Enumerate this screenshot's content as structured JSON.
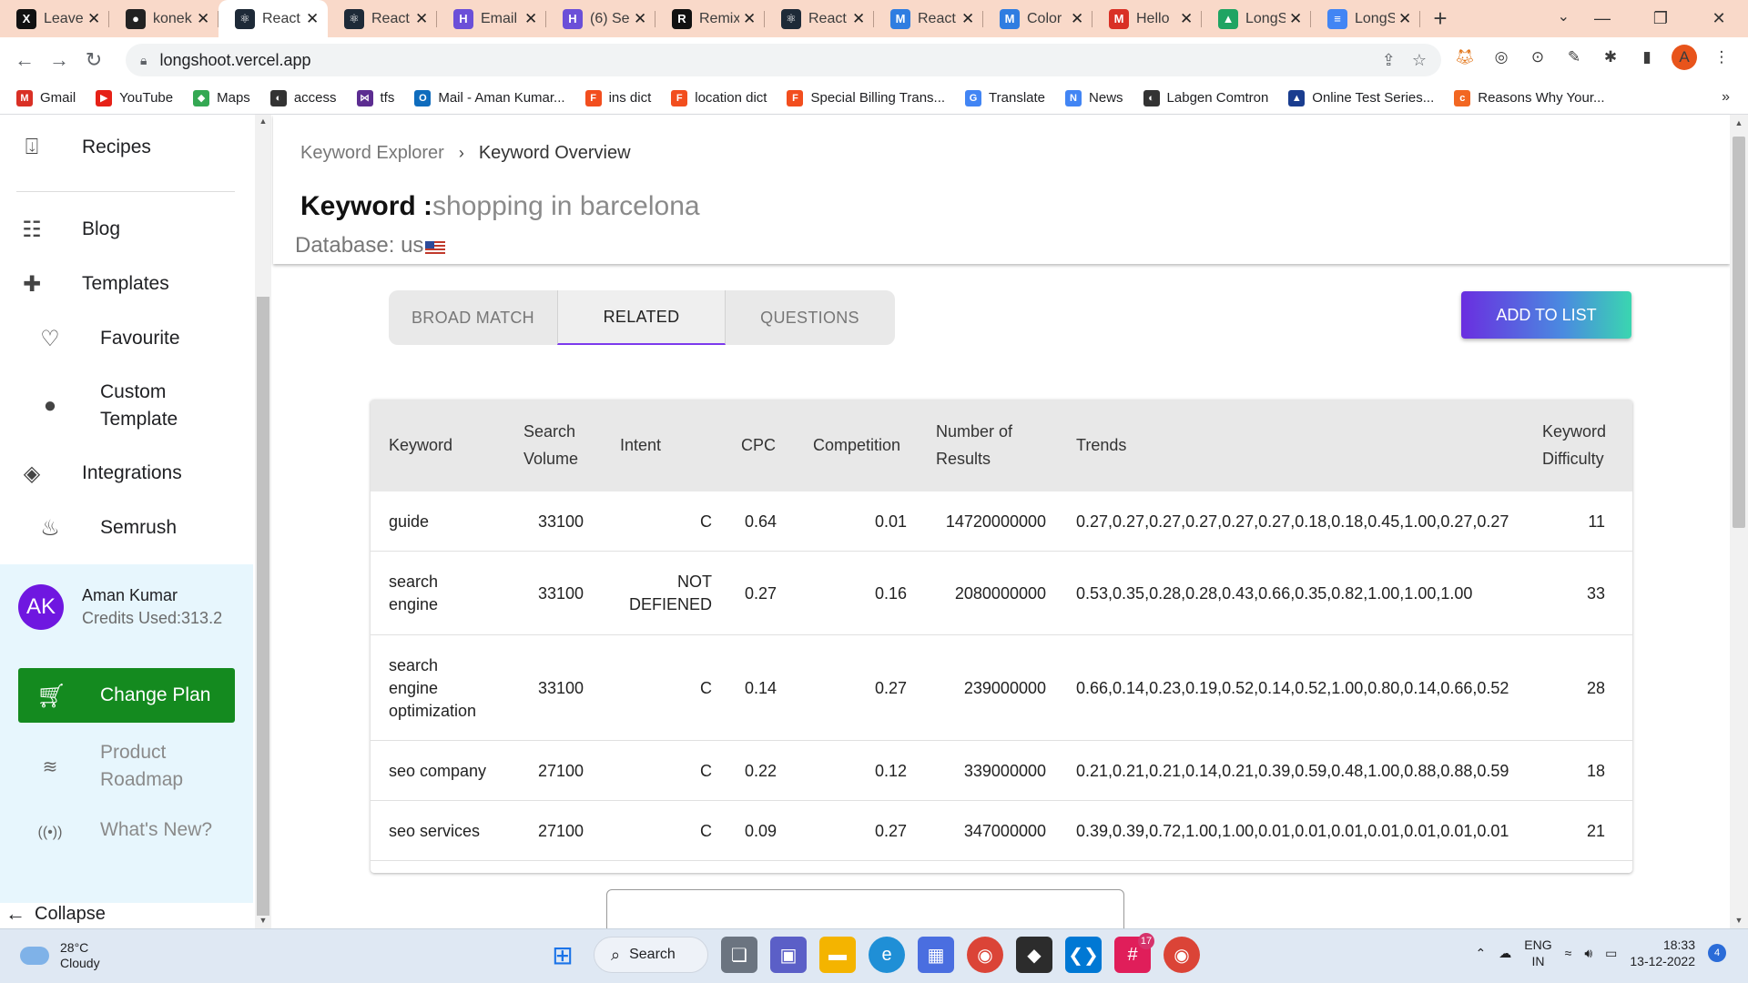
{
  "browser": {
    "tabs": [
      {
        "title": "Leave",
        "icon": "x-logo-icon",
        "color": "#111111",
        "glyph": "X"
      },
      {
        "title": "konek",
        "icon": "github-icon",
        "color": "#222222",
        "glyph": "●"
      },
      {
        "title": "React",
        "icon": "react-icon",
        "color": "#1e2a38",
        "glyph": "⚛",
        "active": true
      },
      {
        "title": "React",
        "icon": "react-icon",
        "color": "#1e2a38",
        "glyph": "⚛"
      },
      {
        "title": "Email",
        "icon": "hashnode-icon",
        "color": "#6b4fd8",
        "glyph": "H"
      },
      {
        "title": "(6) Se",
        "icon": "hashnode-icon",
        "color": "#6b4fd8",
        "glyph": "H"
      },
      {
        "title": "Remix",
        "icon": "remix-icon",
        "color": "#111111",
        "glyph": "R"
      },
      {
        "title": "React",
        "icon": "react-icon",
        "color": "#1e2a38",
        "glyph": "⚛"
      },
      {
        "title": "React",
        "icon": "mui-icon",
        "color": "#2f7de1",
        "glyph": "M"
      },
      {
        "title": "Color",
        "icon": "mui-icon",
        "color": "#2f7de1",
        "glyph": "M"
      },
      {
        "title": "Hello",
        "icon": "gmail-icon",
        "color": "#d93025",
        "glyph": "M"
      },
      {
        "title": "LongS",
        "icon": "drive-icon",
        "color": "#1fa463",
        "glyph": "▲"
      },
      {
        "title": "LongS",
        "icon": "docs-icon",
        "color": "#4285f4",
        "glyph": "≡"
      }
    ],
    "url": "longshoot.vercel.app",
    "profile_initial": "A",
    "bookmarks": [
      {
        "label": "Gmail",
        "icon": "gmail-icon",
        "color": "#d93025",
        "glyph": "M"
      },
      {
        "label": "YouTube",
        "icon": "youtube-icon",
        "color": "#e62117",
        "glyph": "▶"
      },
      {
        "label": "Maps",
        "icon": "maps-icon",
        "color": "#34a853",
        "glyph": "◆"
      },
      {
        "label": "access",
        "icon": "globe-icon",
        "color": "#333333",
        "glyph": "◐"
      },
      {
        "label": "tfs",
        "icon": "visualstudio-icon",
        "color": "#5c2d91",
        "glyph": "⋈"
      },
      {
        "label": "Mail - Aman Kumar...",
        "icon": "outlook-icon",
        "color": "#0f6cbd",
        "glyph": "O"
      },
      {
        "label": "ins dict",
        "icon": "figma-icon",
        "color": "#f24e1e",
        "glyph": "F"
      },
      {
        "label": "location dict",
        "icon": "figma-icon",
        "color": "#f24e1e",
        "glyph": "F"
      },
      {
        "label": "Special Billing Trans...",
        "icon": "figma-icon",
        "color": "#f24e1e",
        "glyph": "F"
      },
      {
        "label": "Translate",
        "icon": "translate-icon",
        "color": "#4285f4",
        "glyph": "G"
      },
      {
        "label": "News",
        "icon": "news-icon",
        "color": "#4285f4",
        "glyph": "N"
      },
      {
        "label": "Labgen Comtron",
        "icon": "globe-icon",
        "color": "#333333",
        "glyph": "◐"
      },
      {
        "label": "Online Test Series...",
        "icon": "test-series-icon",
        "color": "#1a3d8f",
        "glyph": "▲"
      },
      {
        "label": "Reasons Why Your...",
        "icon": "ck-icon",
        "color": "#f26722",
        "glyph": "c"
      }
    ]
  },
  "sidebar": {
    "recipes": "Recipes",
    "blog": "Blog",
    "templates": "Templates",
    "favourite": "Favourite",
    "custom_template_1": "Custom",
    "custom_template_2": "Template",
    "integrations": "Integrations",
    "semrush": "Semrush",
    "user": {
      "initials": "AK",
      "name": "Aman Kumar",
      "credits": "Credits Used:313.2"
    },
    "change_plan": "Change Plan",
    "product_roadmap_1": "Product",
    "product_roadmap_2": "Roadmap",
    "whats_new": "What's New?",
    "collapse": "Collapse"
  },
  "main": {
    "breadcrumb": {
      "parent": "Keyword Explorer",
      "current": "Keyword Overview"
    },
    "keyword_label": "Keyword :",
    "keyword_value": "shopping in barcelona",
    "database_label": "Database: us",
    "tabs": [
      "BROAD MATCH",
      "RELATED",
      "QUESTIONS"
    ],
    "active_tab": "RELATED",
    "add_to_list": "ADD TO LIST",
    "accent_color": "#7c3aed",
    "table": {
      "headers": {
        "keyword": "Keyword",
        "search_volume_1": "Search",
        "search_volume_2": "Volume",
        "intent": "Intent",
        "cpc": "CPC",
        "competition": "Competition",
        "results_1": "Number of",
        "results_2": "Results",
        "trends": "Trends",
        "difficulty_1": "Keyword",
        "difficulty_2": "Difficulty"
      },
      "rows": [
        {
          "keyword": [
            "guide"
          ],
          "volume": "33100",
          "intent": [
            "C"
          ],
          "cpc": "0.64",
          "competition": "0.01",
          "results": "14720000000",
          "trends": "0.27,0.27,0.27,0.27,0.27,0.27,0.18,0.18,0.45,1.00,0.27,0.27",
          "difficulty": "11"
        },
        {
          "keyword": [
            "search",
            "engine"
          ],
          "volume": "33100",
          "intent": [
            "NOT",
            "DEFIENED"
          ],
          "cpc": "0.27",
          "competition": "0.16",
          "results": "2080000000",
          "trends": "0.53,0.35,0.28,0.28,0.43,0.66,0.35,0.82,1.00,1.00,1.00",
          "difficulty": "33"
        },
        {
          "keyword": [
            "search",
            "engine",
            "optimization"
          ],
          "volume": "33100",
          "intent": [
            "C"
          ],
          "cpc": "0.14",
          "competition": "0.27",
          "results": "239000000",
          "trends": "0.66,0.14,0.23,0.19,0.52,0.14,0.52,1.00,0.80,0.14,0.66,0.52",
          "difficulty": "28"
        },
        {
          "keyword": [
            "seo company"
          ],
          "volume": "27100",
          "intent": [
            "C"
          ],
          "cpc": "0.22",
          "competition": "0.12",
          "results": "339000000",
          "trends": "0.21,0.21,0.21,0.14,0.21,0.39,0.59,0.48,1.00,0.88,0.88,0.59",
          "difficulty": "18"
        },
        {
          "keyword": [
            "seo services"
          ],
          "volume": "27100",
          "intent": [
            "C"
          ],
          "cpc": "0.09",
          "competition": "0.27",
          "results": "347000000",
          "trends": "0.39,0.39,0.72,1.00,1.00,0.01,0.01,0.01,0.01,0.01,0.01,0.01",
          "difficulty": "21"
        }
      ]
    }
  },
  "taskbar": {
    "temperature": "28°C",
    "weather": "Cloudy",
    "search": "Search",
    "slack_badge": "17",
    "lang_1": "ENG",
    "lang_2": "IN",
    "time": "18:33",
    "date": "13-12-2022",
    "notification_count": "4"
  }
}
